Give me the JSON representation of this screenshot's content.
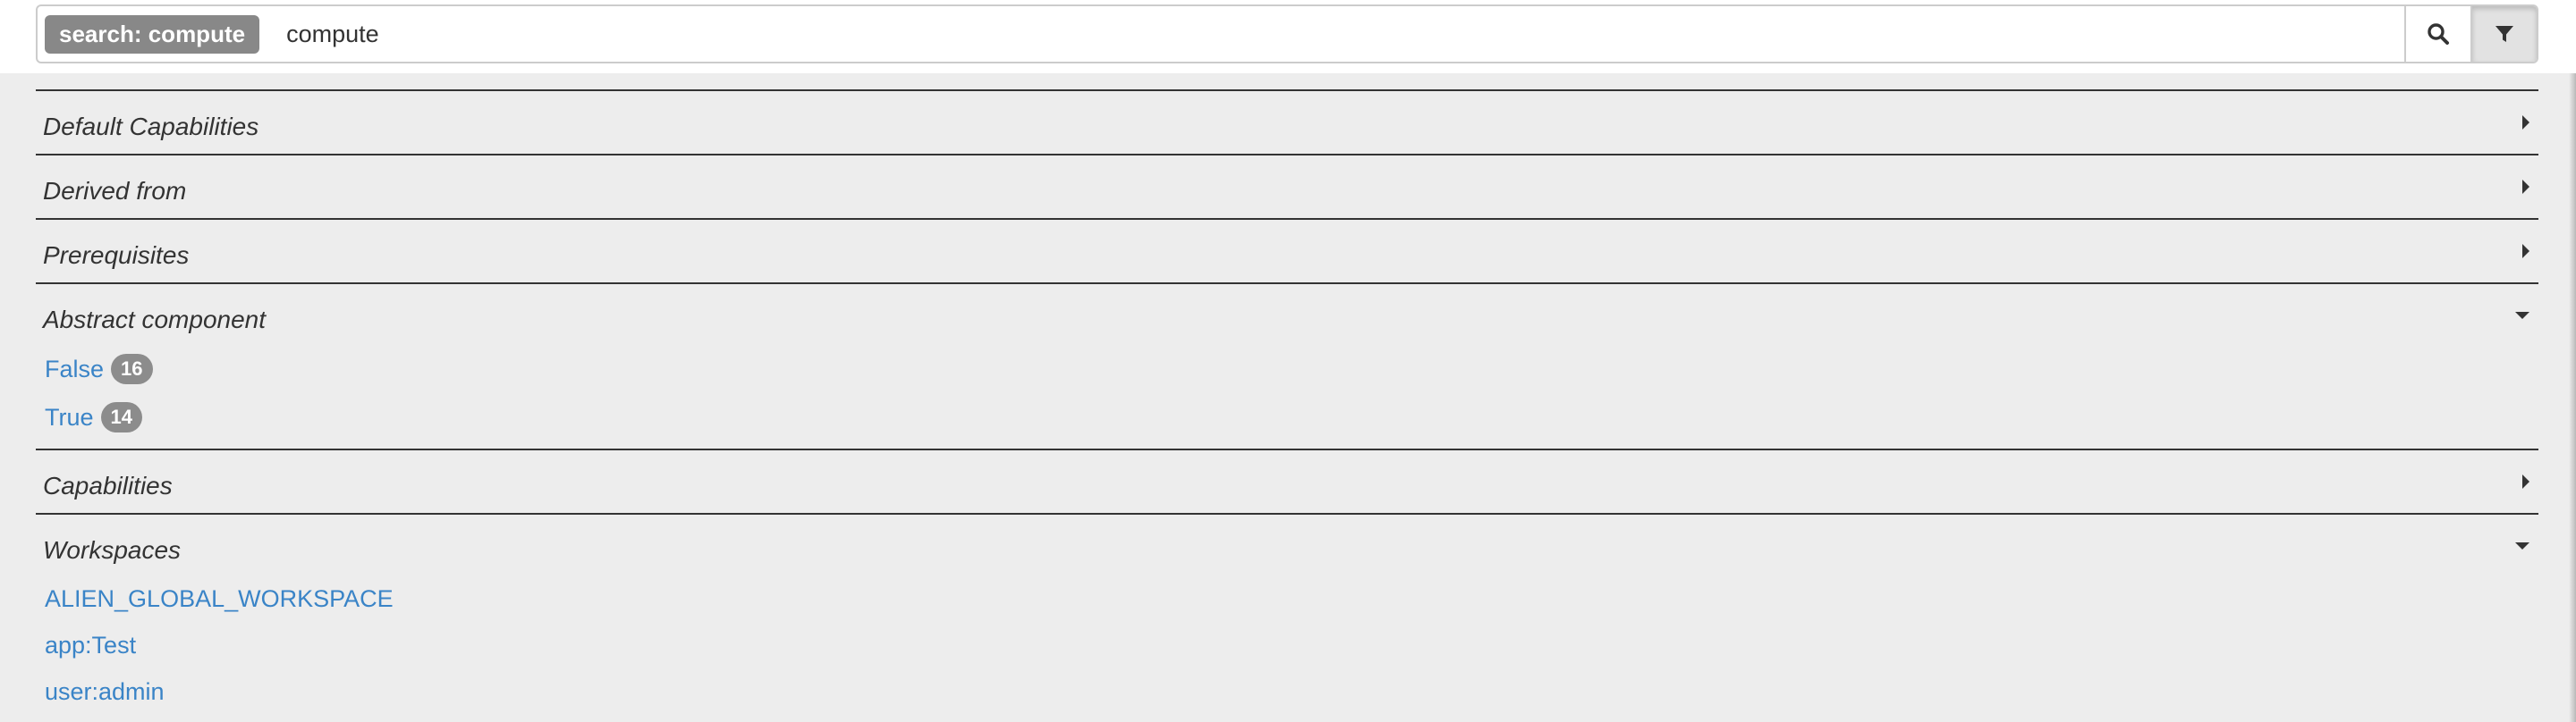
{
  "search": {
    "tag": "search: compute",
    "value": "compute",
    "placeholder": ""
  },
  "icons": {
    "search": "search-icon",
    "filter": "filter-icon",
    "collapsed": "caret-right-icon",
    "expanded": "caret-down-icon"
  },
  "colors": {
    "link": "#3a84c7",
    "badge": "#8c8c8c",
    "tag": "#888888",
    "background": "#ededed"
  },
  "facets": [
    {
      "title": "Default Capabilities",
      "expanded": false,
      "items": []
    },
    {
      "title": "Derived from",
      "expanded": false,
      "items": []
    },
    {
      "title": "Prerequisites",
      "expanded": false,
      "items": []
    },
    {
      "title": "Abstract component",
      "expanded": true,
      "items": [
        {
          "label": "False",
          "count": "16"
        },
        {
          "label": "True",
          "count": "14"
        }
      ]
    },
    {
      "title": "Capabilities",
      "expanded": false,
      "items": []
    },
    {
      "title": "Workspaces",
      "expanded": true,
      "items": [
        {
          "label": "ALIEN_GLOBAL_WORKSPACE"
        },
        {
          "label": "app:Test"
        },
        {
          "label": "user:admin"
        }
      ]
    }
  ]
}
